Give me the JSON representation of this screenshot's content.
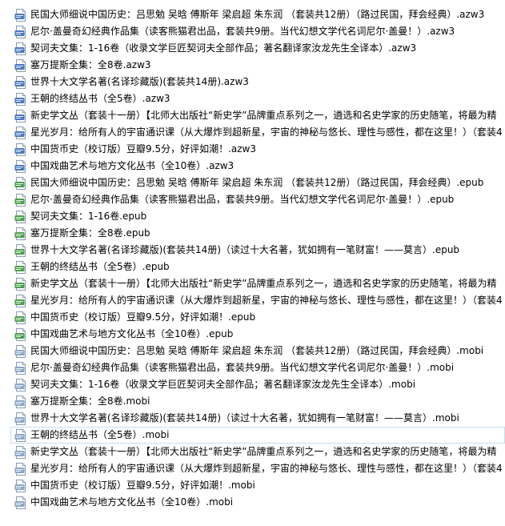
{
  "colors": {
    "azw3_icon": "#4a78c2",
    "epub_icon": "#4aa04a",
    "mobi_icon": "#8aa6c8",
    "selection_border": "#c6dcf5"
  },
  "files": [
    {
      "name": "民国大师细说中国历史：吕思勉 吴晗 傅斯年 梁启超 朱东润 （套装共12册）（路过民国，拜会经典）.azw3",
      "type": "azw3",
      "icon": "azw3-file-icon"
    },
    {
      "name": "尼尔·盖曼奇幻经典作品集（读客熊猫君出品，套装共9册。当代幻想文学代名词尼尔·盖曼！）.azw3",
      "type": "azw3",
      "icon": "azw3-file-icon"
    },
    {
      "name": "契诃夫文集：1-16卷（收录文学巨匠契诃夫全部作品；著名翻译家汝龙先生全译本）.azw3",
      "type": "azw3",
      "icon": "azw3-file-icon"
    },
    {
      "name": "塞万提斯全集：全8卷.azw3",
      "type": "azw3",
      "icon": "azw3-file-icon"
    },
    {
      "name": "世界十大文学名著(名译珍藏版)(套装共14册).azw3",
      "type": "azw3",
      "icon": "azw3-file-icon"
    },
    {
      "name": "王朝的终结丛书（全5卷）.azw3",
      "type": "azw3",
      "icon": "azw3-file-icon"
    },
    {
      "name": "新史学文丛（套装十一册）【北师大出版社“新史学”品牌重点系列之一，遴选和名史学家的历史随笔，将最为精",
      "type": "azw3",
      "icon": "azw3-file-icon"
    },
    {
      "name": "星光岁月：给所有人的宇宙通识课（从大爆炸到超新星，宇宙的神秘与悠长、理性与感性，都在这里！）（套装4",
      "type": "azw3",
      "icon": "azw3-file-icon"
    },
    {
      "name": "中国货币史（校订版）豆瓣9.5分，好评如潮！.azw3",
      "type": "azw3",
      "icon": "azw3-file-icon"
    },
    {
      "name": "中国戏曲艺术与地方文化丛书（全10卷）.azw3",
      "type": "azw3",
      "icon": "azw3-file-icon"
    },
    {
      "name": "民国大师细说中国历史：吕思勉 吴晗 傅斯年 梁启超 朱东润 （套装共12册）（路过民国，拜会经典）.epub",
      "type": "epub",
      "icon": "epub-file-icon"
    },
    {
      "name": "尼尔·盖曼奇幻经典作品集（读客熊猫君出品，套装共9册。当代幻想文学代名词尼尔·盖曼！）.epub",
      "type": "epub",
      "icon": "epub-file-icon"
    },
    {
      "name": "契诃夫文集：1-16卷.epub",
      "type": "epub",
      "icon": "epub-file-icon"
    },
    {
      "name": "塞万提斯全集：全8卷.epub",
      "type": "epub",
      "icon": "epub-file-icon"
    },
    {
      "name": "世界十大文学名著(名译珍藏版)(套装共14册)（读过十大名著，犹如拥有一笔财富！——莫言）.epub",
      "type": "epub",
      "icon": "epub-file-icon"
    },
    {
      "name": "王朝的终结丛书（全5卷）.epub",
      "type": "epub",
      "icon": "epub-file-icon"
    },
    {
      "name": "新史学文丛（套装十一册）【北师大出版社“新史学”品牌重点系列之一，遴选和名史学家的历史随笔，将最为精",
      "type": "epub",
      "icon": "epub-file-icon"
    },
    {
      "name": "星光岁月：给所有人的宇宙通识课（从大爆炸到超新星，宇宙的神秘与悠长、理性与感性，都在这里！）（套装4",
      "type": "epub",
      "icon": "epub-file-icon"
    },
    {
      "name": "中国货币史（校订版）豆瓣9.5分，好评如潮！.epub",
      "type": "epub",
      "icon": "epub-file-icon"
    },
    {
      "name": "中国戏曲艺术与地方文化丛书（全10卷）.epub",
      "type": "epub",
      "icon": "epub-file-icon"
    },
    {
      "name": "民国大师细说中国历史：吕思勉 吴晗 傅斯年 梁启超 朱东润 （套装共12册）（路过民国，拜会经典）.mobi",
      "type": "mobi",
      "icon": "mobi-file-icon"
    },
    {
      "name": "尼尔·盖曼奇幻经典作品集（读客熊猫君出品，套装共9册。当代幻想文学代名词尼尔·盖曼！）.mobi",
      "type": "mobi",
      "icon": "mobi-file-icon"
    },
    {
      "name": "契诃夫文集：1-16卷（收录文学巨匠契诃夫全部作品；著名翻译家汝龙先生全译本）.mobi",
      "type": "mobi",
      "icon": "mobi-file-icon"
    },
    {
      "name": "塞万提斯全集：全8卷.mobi",
      "type": "mobi",
      "icon": "mobi-file-icon"
    },
    {
      "name": "世界十大文学名著(名译珍藏版)(套装共14册)（读过十大名著，犹如拥有一笔财富！——莫言）.mobi",
      "type": "mobi",
      "icon": "mobi-file-icon"
    },
    {
      "name": "王朝的终结丛书（全5卷）.mobi",
      "type": "mobi",
      "icon": "mobi-file-icon",
      "selected": true
    },
    {
      "name": "新史学文丛（套装十一册）【北师大出版社“新史学”品牌重点系列之一，遴选和名史学家的历史随笔，将最为精",
      "type": "mobi",
      "icon": "mobi-file-icon"
    },
    {
      "name": "星光岁月：给所有人的宇宙通识课（从大爆炸到超新星，宇宙的神秘与悠长、理性与感性，都在这里！）（套装4",
      "type": "mobi",
      "icon": "mobi-file-icon"
    },
    {
      "name": "中国货币史（校订版）豆瓣9.5分，好评如潮！.mobi",
      "type": "mobi",
      "icon": "mobi-file-icon"
    },
    {
      "name": "中国戏曲艺术与地方文化丛书（全10卷）.mobi",
      "type": "mobi",
      "icon": "mobi-file-icon"
    }
  ]
}
